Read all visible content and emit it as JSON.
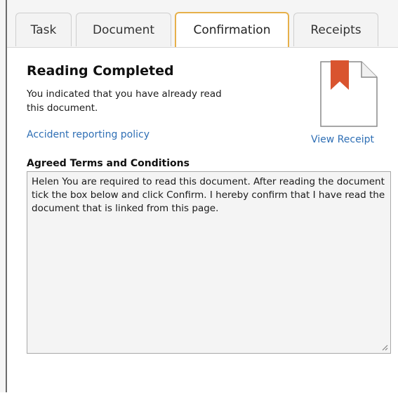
{
  "tabs": [
    {
      "label": "Task",
      "active": false
    },
    {
      "label": "Document",
      "active": false
    },
    {
      "label": "Confirmation",
      "active": true
    },
    {
      "label": "Receipts",
      "active": false
    }
  ],
  "confirmation": {
    "title": "Reading Completed",
    "description": "You indicated that you have already read this document.",
    "document_link": "Accident reporting policy",
    "view_receipt_link": "View Receipt",
    "terms_label": "Agreed Terms and Conditions",
    "terms_text": "Helen You are required to read this document. After reading the document tick the box below and click Confirm. I hereby confirm that I have read the document that is linked from this page."
  },
  "icons": {
    "document": "document-icon",
    "bookmark": "bookmark-icon",
    "resize": "resize-grip-icon"
  },
  "colors": {
    "accent_tab_border": "#e6b04a",
    "link": "#2f6fb5",
    "bookmark": "#d9542f"
  }
}
